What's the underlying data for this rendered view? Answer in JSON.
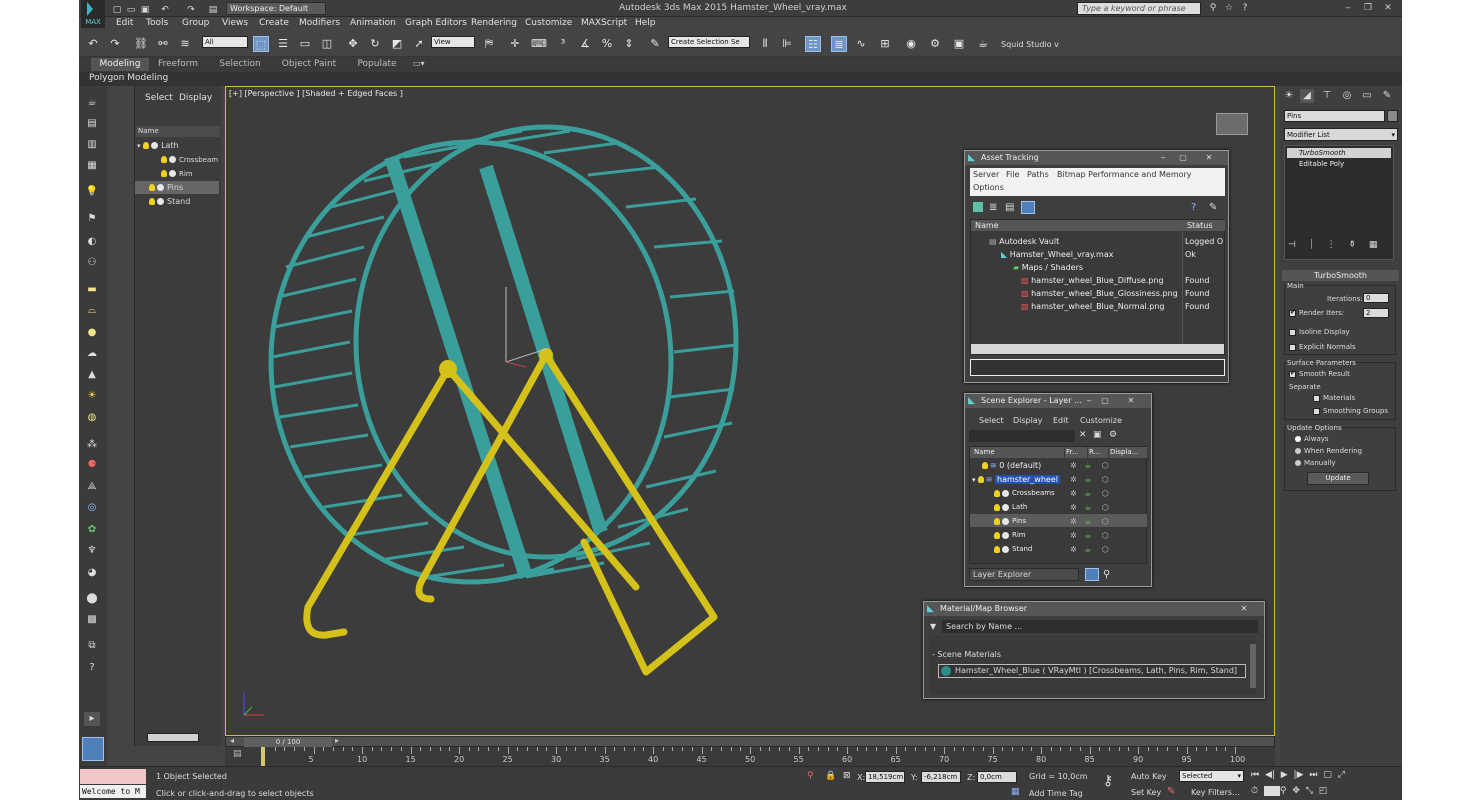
{
  "window": {
    "title": "Autodesk 3ds Max  2015      Hamster_Wheel_vray.max",
    "workspace": "Workspace: Default",
    "search_placeholder": "Type a keyword or phrase",
    "logo_label": "MAX"
  },
  "menu": [
    "Edit",
    "Tools",
    "Group",
    "Views",
    "Create",
    "Modifiers",
    "Animation",
    "Graph Editors",
    "Rendering",
    "Customize",
    "MAXScript",
    "Help"
  ],
  "toolbar": {
    "filter": "All",
    "view": "View",
    "selection_set": "Create Selection Se",
    "studio": "Squid Studio v"
  },
  "ribbon": {
    "tabs": [
      "Modeling",
      "Freeform",
      "Selection",
      "Object Paint",
      "Populate"
    ],
    "active": "Modeling",
    "subtitle": "Polygon Modeling"
  },
  "scene_explorer_side": {
    "tabs": [
      "Select",
      "Display"
    ],
    "column": "Name",
    "items": [
      {
        "label": "Lath",
        "indent": 0
      },
      {
        "label": "Crossbeam",
        "indent": 1
      },
      {
        "label": "Rim",
        "indent": 1
      },
      {
        "label": "Pins",
        "indent": 0,
        "selected": true
      },
      {
        "label": "Stand",
        "indent": 0
      }
    ]
  },
  "viewport": {
    "label": "[+] [Perspective ] [Shaded + Edged Faces ]",
    "colors": {
      "wheel": "#3a9e9b",
      "stand": "#d4c11a",
      "background": "#3c3c3c"
    }
  },
  "command_panel": {
    "object_name": "Pins",
    "modifier_list": "Modifier List",
    "stack": [
      "TurboSmooth",
      "Editable Poly"
    ],
    "rollout": "TurboSmooth",
    "main": "Main",
    "iterations_label": "Iterations:",
    "iterations": "0",
    "render_iters_label": "Render Iters:",
    "render_iters": "2",
    "isoline": "Isoline Display",
    "explicit_normals": "Explicit Normals",
    "surface_params": "Surface Parameters",
    "smooth_result": "Smooth Result",
    "separate": "Separate",
    "materials": "Materials",
    "smoothing_groups": "Smoothing Groups",
    "update_options": "Update Options",
    "always": "Always",
    "when_rendering": "When Rendering",
    "manually": "Manually",
    "update_btn": "Update"
  },
  "asset_tracking": {
    "title": "Asset Tracking",
    "menu": [
      "Server",
      "File",
      "Paths",
      "Bitmap Performance and Memory",
      "Options"
    ],
    "columns": [
      "Name",
      "Status"
    ],
    "rows": [
      {
        "name": "Autodesk Vault",
        "status": "Logged O",
        "indent": 0
      },
      {
        "name": "Hamster_Wheel_vray.max",
        "status": "Ok",
        "indent": 1
      },
      {
        "name": "Maps / Shaders",
        "status": "",
        "indent": 2
      },
      {
        "name": "hamster_wheel_Blue_Diffuse.png",
        "status": "Found",
        "indent": 3
      },
      {
        "name": "hamster_wheel_Blue_Glossiness.png",
        "status": "Found",
        "indent": 3
      },
      {
        "name": "hamster_wheel_Blue_Normal.png",
        "status": "Found",
        "indent": 3
      }
    ]
  },
  "layer_explorer": {
    "title": "Scene Explorer - Layer ...",
    "menu": [
      "Select",
      "Display",
      "Edit",
      "Customize"
    ],
    "columns": [
      "Name",
      "Fr...",
      "R...",
      "Displa..."
    ],
    "rows": [
      {
        "name": "0 (default)",
        "indent": 0,
        "type": "layer"
      },
      {
        "name": "hamster_wheel",
        "indent": 0,
        "type": "layer",
        "highlight": true
      },
      {
        "name": "Crossbeams",
        "indent": 1,
        "type": "obj"
      },
      {
        "name": "Lath",
        "indent": 1,
        "type": "obj"
      },
      {
        "name": "Pins",
        "indent": 1,
        "type": "obj",
        "selected": true
      },
      {
        "name": "Rim",
        "indent": 1,
        "type": "obj"
      },
      {
        "name": "Stand",
        "indent": 1,
        "type": "obj"
      }
    ],
    "footer": "Layer Explorer"
  },
  "material_browser": {
    "title": "Material/Map Browser",
    "search": "Search by Name ...",
    "section": "- Scene Materials",
    "item": "Hamster_Wheel_Blue  ( VRayMtl )  [Crossbeams, Lath, Pins, Rim, Stand]"
  },
  "timeline": {
    "frame": "0 / 100",
    "ticks": [
      "5",
      "10",
      "15",
      "20",
      "25",
      "30",
      "35",
      "40",
      "45",
      "50",
      "55",
      "60",
      "65",
      "70",
      "75",
      "80",
      "85",
      "90",
      "95",
      "100"
    ]
  },
  "status": {
    "welcome": "Welcome to M",
    "selected": "1 Object Selected",
    "hint": "Click or click-and-drag to select objects",
    "x_label": "X:",
    "x": "18,519cm",
    "y_label": "Y:",
    "y": "-6,218cm",
    "z_label": "Z:",
    "z": "0,0cm",
    "grid": "Grid = 10,0cm",
    "add_time_tag": "Add Time Tag",
    "auto_key": "Auto Key",
    "set_key": "Set Key",
    "selected_dd": "Selected",
    "key_filters": "Key Filters..."
  }
}
